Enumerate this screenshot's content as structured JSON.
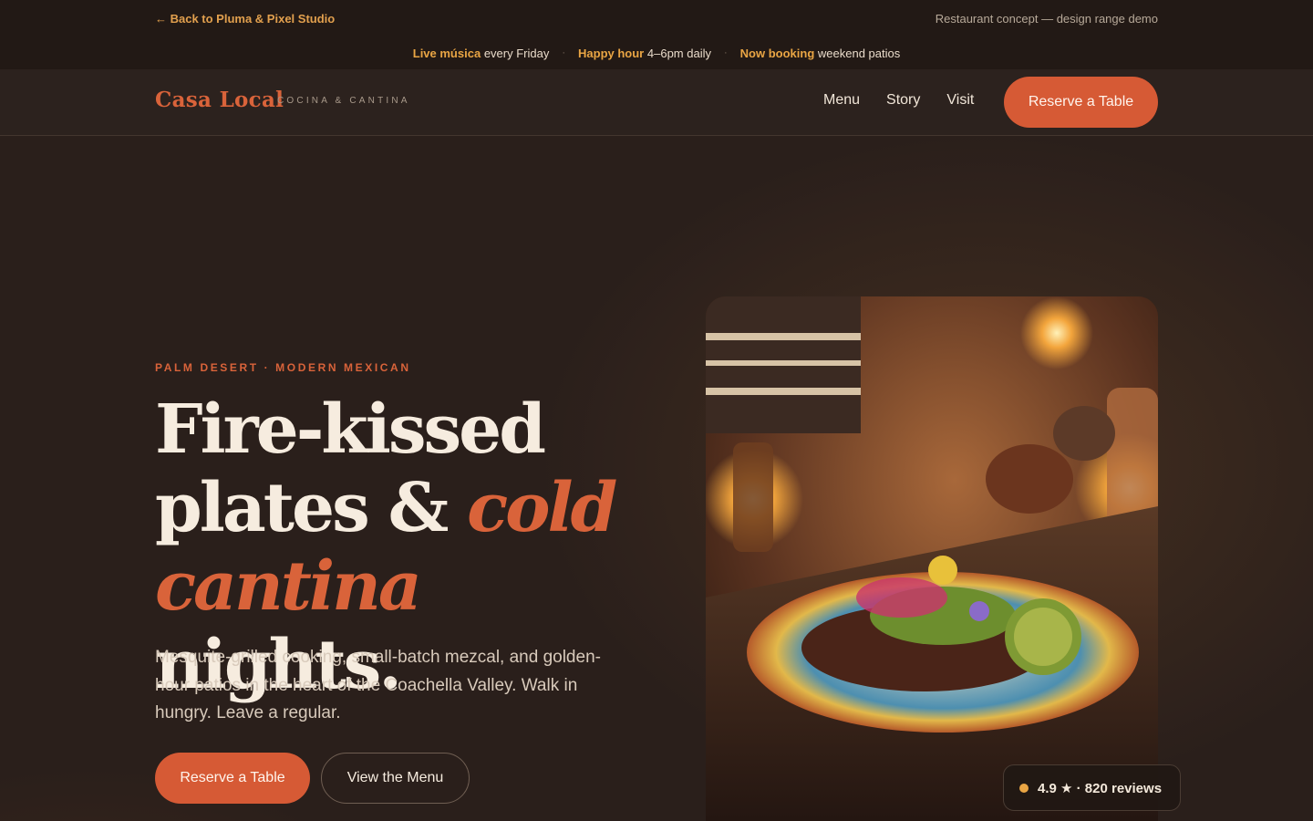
{
  "topbar": {
    "back_link": "← Back to Pluma & Pixel Studio",
    "concept_note": "Restaurant concept — design range demo",
    "announcements": [
      {
        "highlight": "Live música",
        "text": "every Friday"
      },
      {
        "highlight": "Happy hour",
        "text": "4–6pm daily"
      },
      {
        "highlight": "Now booking",
        "text": "weekend patios"
      }
    ],
    "separator": "·"
  },
  "nav": {
    "logo": "Casa Local",
    "logo_sub": "COCINA & CANTINA",
    "links": [
      "Menu",
      "Story",
      "Visit"
    ],
    "cta": "Reserve a Table"
  },
  "hero": {
    "eyebrow": "PALM DESERT · MODERN MEXICAN",
    "headline": {
      "part1": "Fire-kissed plates & ",
      "accent1": "cold",
      "part2": " ",
      "accent2": "cantina",
      "part3": " nights."
    },
    "lede": "Mesquite-grilled cooking, small-batch mezcal, and golden-hour patios in the heart of the Coachella Valley. Walk in hungry. Leave a regular.",
    "primary_button": "Reserve a Table",
    "secondary_button": "View the Menu",
    "rating": "4.9 ★ · 820 reviews"
  },
  "colors": {
    "accent": "#d65a35",
    "gold": "#e9a544",
    "background": "#2a1f1b",
    "text": "#f6ecdf"
  },
  "icons": [
    "arrow-left-icon",
    "rating-dot-icon"
  ]
}
